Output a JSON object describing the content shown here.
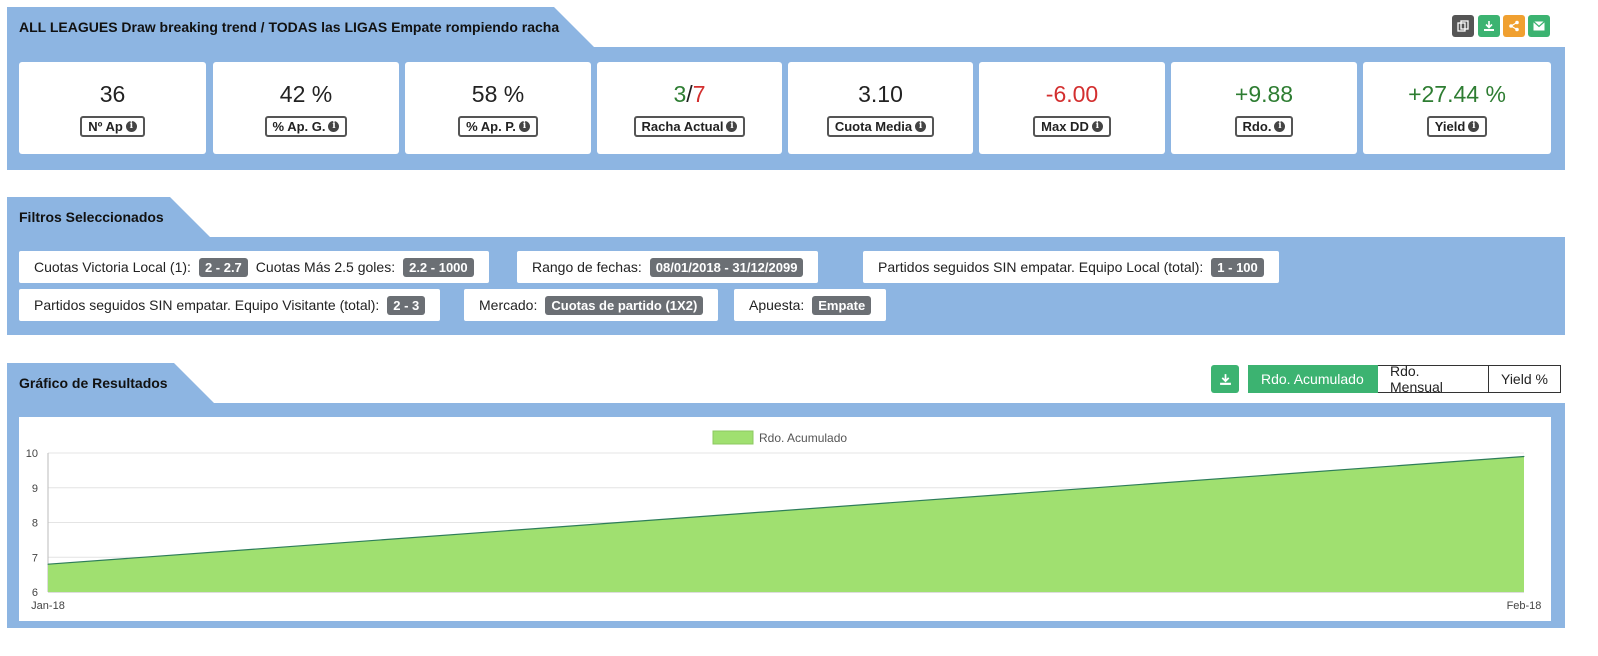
{
  "header": {
    "title": "ALL LEAGUES Draw breaking trend / TODAS las LIGAS Empate rompiendo racha"
  },
  "toolbar": {
    "icons": [
      {
        "name": "copy-icon",
        "color": "#555555",
        "glyph": "⧉"
      },
      {
        "name": "download-icon",
        "color": "#3cb371",
        "glyph": "⤓"
      },
      {
        "name": "share-icon",
        "color": "#f0a030",
        "glyph": "⋖"
      },
      {
        "name": "email-icon",
        "color": "#3cb371",
        "glyph": "✉"
      }
    ]
  },
  "stats": [
    {
      "value": "36",
      "label": "Nº Ap",
      "color": "#222222"
    },
    {
      "value": "42 %",
      "label": "% Ap. G.",
      "color": "#222222"
    },
    {
      "value": "58 %",
      "label": "% Ap. P.",
      "color": "#222222"
    },
    {
      "value_a": "3",
      "value_sep": "/",
      "value_b": "7",
      "label": "Racha Actual"
    },
    {
      "value": "3.10",
      "label": "Cuota Media",
      "color": "#222222"
    },
    {
      "value": "-6.00",
      "label": "Max DD",
      "color": "#d32f2f"
    },
    {
      "value": "+9.88",
      "label": "Rdo.",
      "color": "#2e7d32"
    },
    {
      "value": "+27.44 %",
      "label": "Yield",
      "color": "#2e7d32"
    }
  ],
  "filters": {
    "title": "Filtros Seleccionados",
    "items": [
      {
        "label": "Cuotas Victoria Local (1):",
        "badge": "2 - 2.7",
        "label2": "Cuotas Más 2.5 goles:",
        "badge2": "2.2 - 1000"
      },
      {
        "label": "Rango de fechas:",
        "badge": "08/01/2018 - 31/12/2099"
      },
      {
        "label": "Partidos seguidos SIN empatar. Equipo Local (total):",
        "badge": "1 - 100"
      },
      {
        "label": "Partidos seguidos SIN empatar. Equipo Visitante (total):",
        "badge": "2 - 3"
      },
      {
        "label": "Mercado:",
        "badge": "Cuotas de partido (1X2)"
      },
      {
        "label": "Apuesta:",
        "badge": "Empate"
      }
    ]
  },
  "results": {
    "title": "Gráfico de Resultados",
    "buttons": [
      "Rdo. Acumulado",
      "Rdo. Mensual",
      "Yield %"
    ],
    "active_button": "Rdo. Acumulado",
    "accent": "#3cb371"
  },
  "chart_data": {
    "type": "area",
    "x": [
      "Jan-18",
      "Feb-18"
    ],
    "series": [
      {
        "name": "Rdo. Acumulado",
        "values": [
          6.8,
          9.9
        ],
        "fill": "#a0e070",
        "stroke": "#2e7d5a"
      }
    ],
    "ylim": [
      6,
      10
    ],
    "yticks": [
      6,
      7,
      8,
      9,
      10
    ],
    "grid": true,
    "legend": "top-center"
  }
}
